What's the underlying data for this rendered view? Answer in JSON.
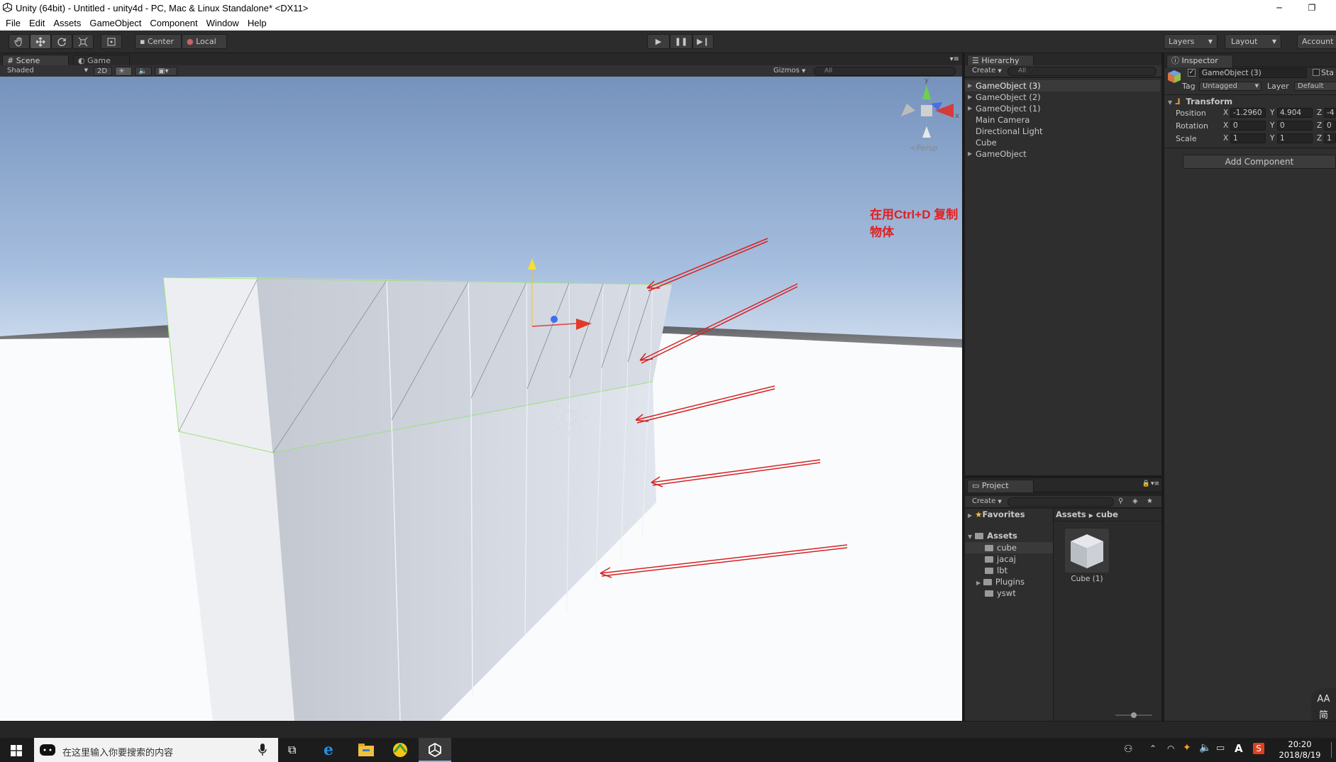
{
  "window": {
    "title": "Unity (64bit) - Untitled - unity4d - PC, Mac & Linux Standalone* <DX11>",
    "minimize": "─",
    "restore": "❐"
  },
  "menu": [
    "File",
    "Edit",
    "Assets",
    "GameObject",
    "Component",
    "Window",
    "Help"
  ],
  "toolbar": {
    "tools": [
      "hand-icon",
      "move-icon",
      "rotate-icon",
      "scale-icon",
      "rect-icon"
    ],
    "pivot": "Center",
    "space": "Local",
    "layers": "Layers",
    "layout": "Layout",
    "account": "Account"
  },
  "scene_panel": {
    "tab_scene": "Scene",
    "tab_game": "Game",
    "shading": "Shaded",
    "mode_2d": "2D",
    "gizmos": "Gizmos",
    "search": "All",
    "gizmo_y": "y",
    "gizmo_x": "x",
    "persp": "Persp",
    "annotation": "在用Ctrl+D 复制物体",
    "annotation_color": "#e02020"
  },
  "hierarchy": {
    "tab": "Hierarchy",
    "create": "Create",
    "search": "All",
    "items": [
      {
        "label": "GameObject (3)",
        "expandable": true,
        "selected": true
      },
      {
        "label": "GameObject (2)",
        "expandable": true,
        "selected": false
      },
      {
        "label": "GameObject (1)",
        "expandable": true,
        "selected": false
      },
      {
        "label": "Main Camera",
        "expandable": false,
        "selected": false
      },
      {
        "label": "Directional Light",
        "expandable": false,
        "selected": false
      },
      {
        "label": "Cube",
        "expandable": false,
        "selected": false
      },
      {
        "label": "GameObject",
        "expandable": true,
        "selected": false
      }
    ]
  },
  "inspector": {
    "tab": "Inspector",
    "object_name": "GameObject (3)",
    "static": "Sta",
    "tag_label": "Tag",
    "tag_value": "Untagged",
    "layer_label": "Layer",
    "layer_value": "Default",
    "component": "Transform",
    "position_label": "Position",
    "rotation_label": "Rotation",
    "scale_label": "Scale",
    "position": {
      "x": "-1.2960",
      "y": "4.904",
      "z": "-4"
    },
    "rotation": {
      "x": "0",
      "y": "0",
      "z": "0"
    },
    "scale": {
      "x": "1",
      "y": "1",
      "z": "1"
    },
    "add_component": "Add Component"
  },
  "project": {
    "tab": "Project",
    "create": "Create",
    "favorites": "Favorites",
    "assets_root": "Assets",
    "folders": [
      "cube",
      "jacaj",
      "lbt",
      "Plugins",
      "yswt"
    ],
    "breadcrumb_root": "Assets",
    "breadcrumb_current": "cube",
    "asset_item": "Cube (1)"
  },
  "taskbar": {
    "search_placeholder": "在这里输入你要搜索的内容",
    "time": "20:20",
    "date": "2018/8/19",
    "ime_top": "AA",
    "ime_bottom": "简"
  }
}
